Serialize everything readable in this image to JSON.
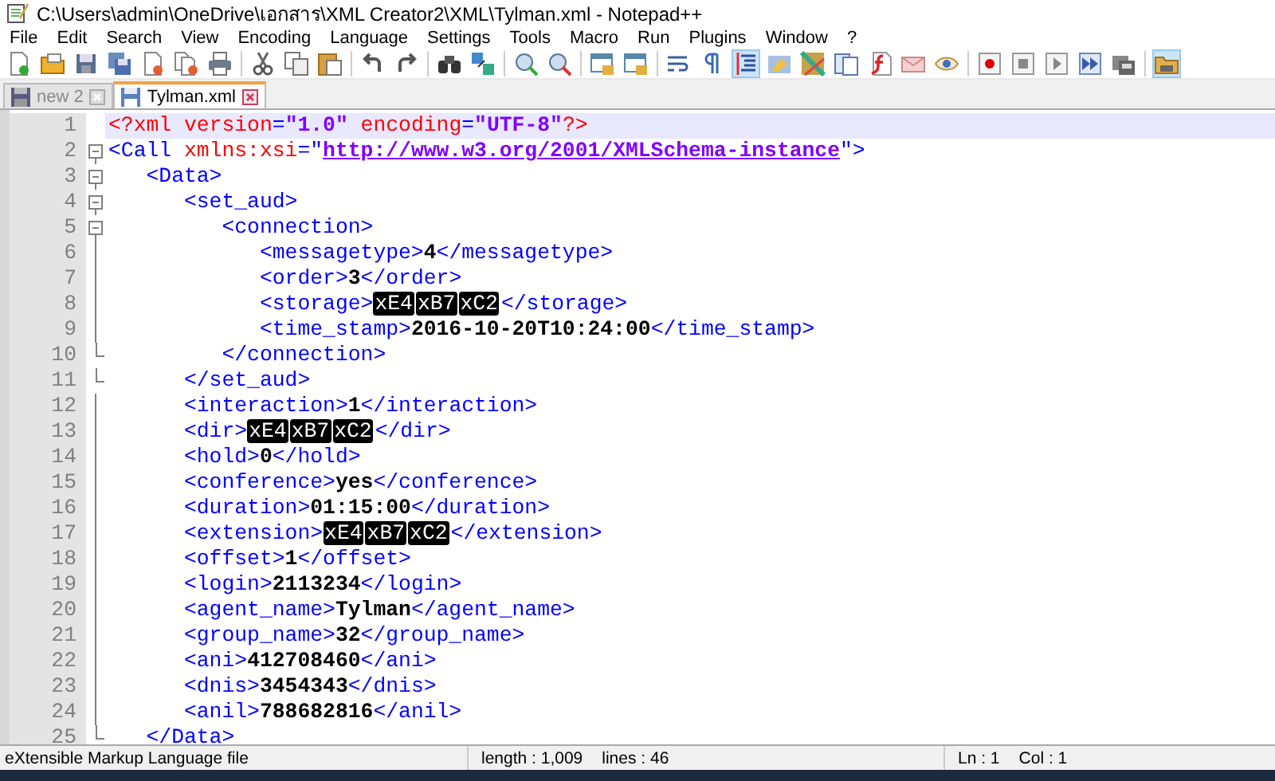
{
  "window": {
    "title": "C:\\Users\\admin\\OneDrive\\เอกสาร\\XML Creator2\\XML\\Tylman.xml - Notepad++"
  },
  "menu": [
    "File",
    "Edit",
    "Search",
    "View",
    "Encoding",
    "Language",
    "Settings",
    "Tools",
    "Macro",
    "Run",
    "Plugins",
    "Window",
    "?"
  ],
  "toolbar": [
    {
      "kind": "new",
      "selected": false
    },
    {
      "kind": "open",
      "selected": false
    },
    {
      "kind": "save",
      "selected": false
    },
    {
      "kind": "save-all",
      "selected": false
    },
    {
      "kind": "close",
      "selected": false
    },
    {
      "kind": "close-all",
      "selected": false
    },
    {
      "kind": "print",
      "selected": false
    },
    {
      "kind": "separator"
    },
    {
      "kind": "cut",
      "selected": false
    },
    {
      "kind": "copy",
      "selected": false
    },
    {
      "kind": "paste",
      "selected": false
    },
    {
      "kind": "separator"
    },
    {
      "kind": "undo",
      "selected": false
    },
    {
      "kind": "redo",
      "selected": false
    },
    {
      "kind": "separator"
    },
    {
      "kind": "find",
      "selected": false
    },
    {
      "kind": "replace",
      "selected": false
    },
    {
      "kind": "separator"
    },
    {
      "kind": "zoom-in",
      "selected": false
    },
    {
      "kind": "zoom-out",
      "selected": false
    },
    {
      "kind": "separator"
    },
    {
      "kind": "sync-v",
      "selected": false
    },
    {
      "kind": "sync-h",
      "selected": false
    },
    {
      "kind": "separator"
    },
    {
      "kind": "wrap",
      "selected": false
    },
    {
      "kind": "pilcrow",
      "selected": false
    },
    {
      "kind": "indent",
      "selected": true
    },
    {
      "kind": "lang",
      "selected": false
    },
    {
      "kind": "map",
      "selected": false
    },
    {
      "kind": "panel",
      "selected": false
    },
    {
      "kind": "function",
      "selected": false
    },
    {
      "kind": "mail",
      "selected": false
    },
    {
      "kind": "eye",
      "selected": false
    },
    {
      "kind": "separator"
    },
    {
      "kind": "record",
      "selected": false
    },
    {
      "kind": "stop",
      "selected": false
    },
    {
      "kind": "play",
      "selected": false
    },
    {
      "kind": "play-multi",
      "selected": false
    },
    {
      "kind": "save-macro",
      "selected": false
    },
    {
      "kind": "separator"
    },
    {
      "kind": "workspace",
      "selected": true
    }
  ],
  "tabs": [
    {
      "label": "new 2",
      "selected": false
    },
    {
      "label": "Tylman.xml",
      "selected": true
    }
  ],
  "editor": {
    "lines": [
      {
        "number": "1",
        "current": true,
        "kind": "plain",
        "tokens": [
          {
            "kind": "decl",
            "text": "<?xml"
          },
          {
            "kind": "attr",
            "text": " version"
          },
          {
            "kind": "tag",
            "text": "="
          },
          {
            "kind": "string",
            "text": "\"1.0\""
          },
          {
            "kind": "attr",
            "text": " encoding"
          },
          {
            "kind": "tag",
            "text": "="
          },
          {
            "kind": "string",
            "text": "\"UTF-8\""
          },
          {
            "kind": "decl",
            "text": "?>"
          }
        ]
      },
      {
        "number": "2",
        "current": false,
        "kind": "start",
        "tokens": [
          {
            "kind": "tag",
            "text": "<Call"
          },
          {
            "kind": "attr",
            "text": " xmlns:xsi"
          },
          {
            "kind": "tag",
            "text": "=\""
          },
          {
            "kind": "link",
            "text": "http://www.w3.org/2001/XMLSchema-instance"
          },
          {
            "kind": "tag",
            "text": "\">"
          }
        ]
      },
      {
        "number": "3",
        "current": false,
        "kind": "start",
        "tokens": [
          {
            "kind": "tag",
            "text": "   <Data>"
          }
        ]
      },
      {
        "number": "4",
        "current": false,
        "kind": "start",
        "tokens": [
          {
            "kind": "tag",
            "text": "      <set_aud>"
          }
        ]
      },
      {
        "number": "5",
        "current": false,
        "kind": "start",
        "tokens": [
          {
            "kind": "tag",
            "text": "         <connection>"
          }
        ]
      },
      {
        "number": "6",
        "current": false,
        "kind": "guide",
        "tokens": [
          {
            "kind": "tag",
            "text": "            <messagetype>"
          },
          {
            "kind": "value",
            "text": "4"
          },
          {
            "kind": "tag",
            "text": "</messagetype>"
          }
        ]
      },
      {
        "number": "7",
        "current": false,
        "kind": "guide",
        "tokens": [
          {
            "kind": "tag",
            "text": "            <order>"
          },
          {
            "kind": "value",
            "text": "3"
          },
          {
            "kind": "tag",
            "text": "</order>"
          }
        ]
      },
      {
        "number": "8",
        "current": false,
        "kind": "guide",
        "tokens": [
          {
            "kind": "tag",
            "text": "            <storage>"
          },
          {
            "kind": "ctrl",
            "text": "xE4"
          },
          {
            "kind": "ctrl",
            "text": "xB7"
          },
          {
            "kind": "ctrl",
            "text": "xC2"
          },
          {
            "kind": "tag",
            "text": "</storage>"
          }
        ]
      },
      {
        "number": "9",
        "current": false,
        "kind": "guide",
        "tokens": [
          {
            "kind": "tag",
            "text": "            <time_stamp>"
          },
          {
            "kind": "value",
            "text": "2016-10-20T10:24:00"
          },
          {
            "kind": "tag",
            "text": "</time_stamp>"
          }
        ]
      },
      {
        "number": "10",
        "current": false,
        "kind": "end",
        "tokens": [
          {
            "kind": "tag",
            "text": "         </connection>"
          }
        ]
      },
      {
        "number": "11",
        "current": false,
        "kind": "end",
        "tokens": [
          {
            "kind": "tag",
            "text": "      </set_aud>"
          }
        ]
      },
      {
        "number": "12",
        "current": false,
        "kind": "guide",
        "tokens": [
          {
            "kind": "tag",
            "text": "      <interaction>"
          },
          {
            "kind": "value",
            "text": "1"
          },
          {
            "kind": "tag",
            "text": "</interaction>"
          }
        ]
      },
      {
        "number": "13",
        "current": false,
        "kind": "guide",
        "tokens": [
          {
            "kind": "tag",
            "text": "      <dir>"
          },
          {
            "kind": "ctrl",
            "text": "xE4"
          },
          {
            "kind": "ctrl",
            "text": "xB7"
          },
          {
            "kind": "ctrl",
            "text": "xC2"
          },
          {
            "kind": "tag",
            "text": "</dir>"
          }
        ]
      },
      {
        "number": "14",
        "current": false,
        "kind": "guide",
        "tokens": [
          {
            "kind": "tag",
            "text": "      <hold>"
          },
          {
            "kind": "value",
            "text": "0"
          },
          {
            "kind": "tag",
            "text": "</hold>"
          }
        ]
      },
      {
        "number": "15",
        "current": false,
        "kind": "guide",
        "tokens": [
          {
            "kind": "tag",
            "text": "      <conference>"
          },
          {
            "kind": "value",
            "text": "yes"
          },
          {
            "kind": "tag",
            "text": "</conference>"
          }
        ]
      },
      {
        "number": "16",
        "current": false,
        "kind": "guide",
        "tokens": [
          {
            "kind": "tag",
            "text": "      <duration>"
          },
          {
            "kind": "value",
            "text": "01:15:00"
          },
          {
            "kind": "tag",
            "text": "</duration>"
          }
        ]
      },
      {
        "number": "17",
        "current": false,
        "kind": "guide",
        "tokens": [
          {
            "kind": "tag",
            "text": "      <extension>"
          },
          {
            "kind": "ctrl",
            "text": "xE4"
          },
          {
            "kind": "ctrl",
            "text": "xB7"
          },
          {
            "kind": "ctrl",
            "text": "xC2"
          },
          {
            "kind": "tag",
            "text": "</extension>"
          }
        ]
      },
      {
        "number": "18",
        "current": false,
        "kind": "guide",
        "tokens": [
          {
            "kind": "tag",
            "text": "      <offset>"
          },
          {
            "kind": "value",
            "text": "1"
          },
          {
            "kind": "tag",
            "text": "</offset>"
          }
        ]
      },
      {
        "number": "19",
        "current": false,
        "kind": "guide",
        "tokens": [
          {
            "kind": "tag",
            "text": "      <login>"
          },
          {
            "kind": "value",
            "text": "2113234"
          },
          {
            "kind": "tag",
            "text": "</login>"
          }
        ]
      },
      {
        "number": "20",
        "current": false,
        "kind": "guide",
        "tokens": [
          {
            "kind": "tag",
            "text": "      <agent_name>"
          },
          {
            "kind": "value",
            "text": "Tylman"
          },
          {
            "kind": "tag",
            "text": "</agent_name>"
          }
        ]
      },
      {
        "number": "21",
        "current": false,
        "kind": "guide",
        "tokens": [
          {
            "kind": "tag",
            "text": "      <group_name>"
          },
          {
            "kind": "value",
            "text": "32"
          },
          {
            "kind": "tag",
            "text": "</group_name>"
          }
        ]
      },
      {
        "number": "22",
        "current": false,
        "kind": "guide",
        "tokens": [
          {
            "kind": "tag",
            "text": "      <ani>"
          },
          {
            "kind": "value",
            "text": "412708460"
          },
          {
            "kind": "tag",
            "text": "</ani>"
          }
        ]
      },
      {
        "number": "23",
        "current": false,
        "kind": "guide",
        "tokens": [
          {
            "kind": "tag",
            "text": "      <dnis>"
          },
          {
            "kind": "value",
            "text": "3454343"
          },
          {
            "kind": "tag",
            "text": "</dnis>"
          }
        ]
      },
      {
        "number": "24",
        "current": false,
        "kind": "guide",
        "tokens": [
          {
            "kind": "tag",
            "text": "      <anil>"
          },
          {
            "kind": "value",
            "text": "788682816"
          },
          {
            "kind": "tag",
            "text": "</anil>"
          }
        ]
      },
      {
        "number": "25",
        "current": false,
        "kind": "end",
        "tokens": [
          {
            "kind": "tag",
            "text": "   </Data>"
          }
        ]
      }
    ]
  },
  "status_bar": {
    "file_type": "eXtensible Markup Language file",
    "length": "length : 1,009",
    "lines": "lines : 46",
    "position_line": "Ln : 1",
    "position_col": "Col : 1"
  }
}
